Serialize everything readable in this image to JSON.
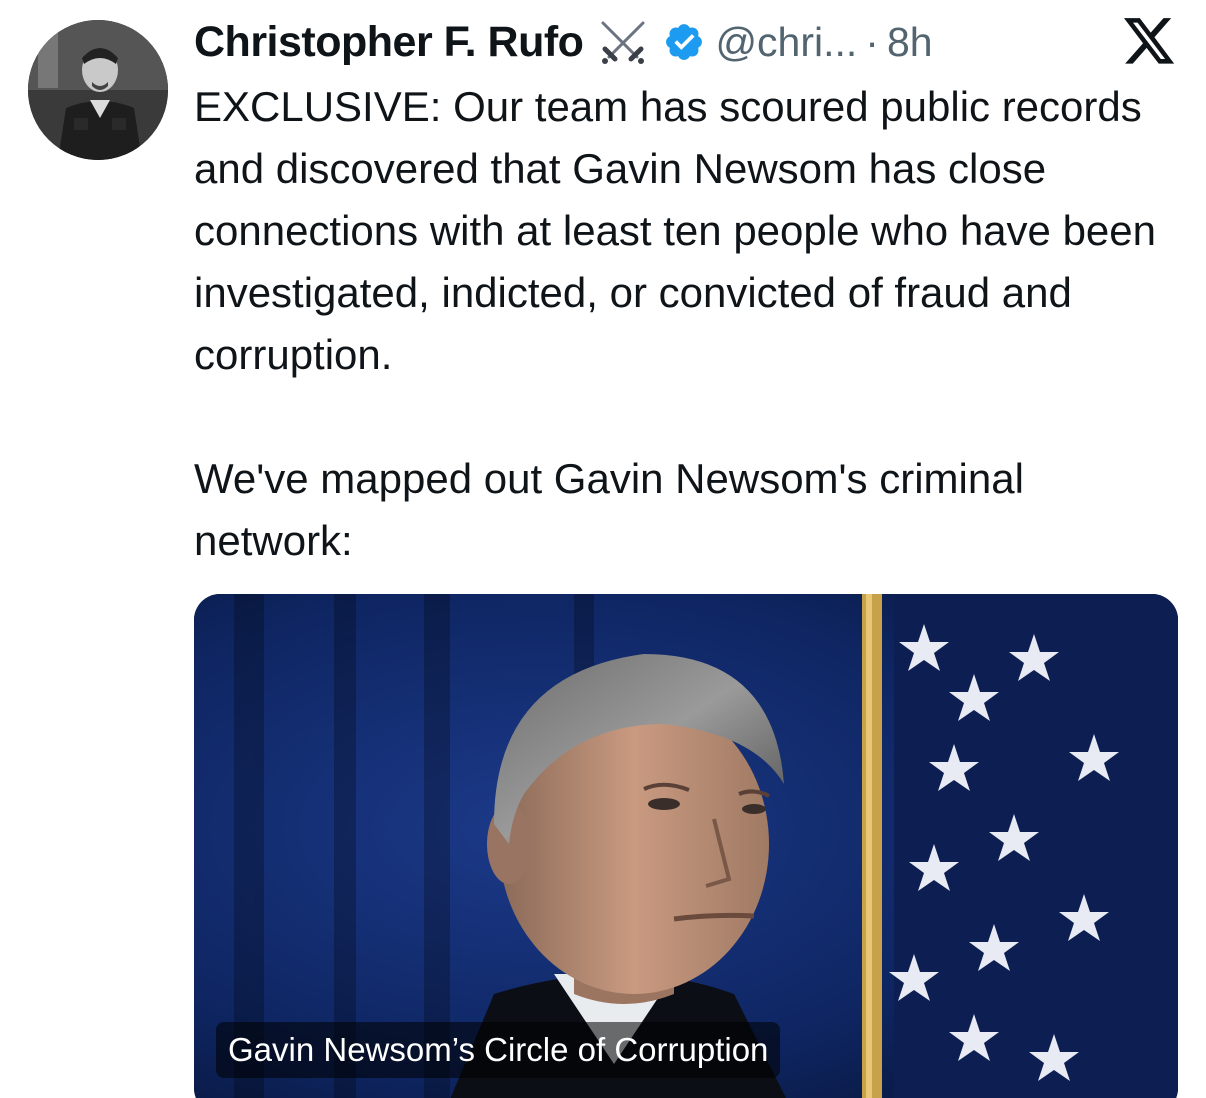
{
  "tweet": {
    "author": {
      "display_name": "Christopher F. Rufo",
      "handle": "@chri...",
      "separator": "·",
      "time": "8h"
    },
    "paragraphs": [
      "EXCLUSIVE: Our team has scoured public records and discovered that Gavin Newsom has close connections with at least ten people who have been investigated, indicted, or convicted of fraud and corruption.",
      "We've mapped out Gavin Newsom's criminal network:"
    ],
    "media": {
      "caption": "Gavin Newsom’s Circle of Corruption"
    }
  },
  "icons": {
    "badge": "crossed-swords-icon",
    "verified": "verified-badge-icon",
    "platform": "x-logo-icon"
  },
  "colors": {
    "text": "#0f1419",
    "secondary": "#536471",
    "verified": "#1d9bf0",
    "media_bg": "#0a1a3f"
  }
}
